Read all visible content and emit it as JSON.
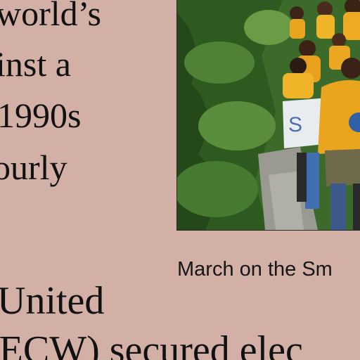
{
  "text_lines": [
    "world’s",
    "inst a",
    "1990s",
    "ourly",
    "United",
    "IECW) secured elec"
  ],
  "photo": {
    "caption": "March on the Sm",
    "sign_text": "S"
  },
  "colors": {
    "page_background": "#d2b0a5",
    "text": "#111111",
    "foliage": "#2f5a22",
    "shirt": "#e9a51e"
  }
}
